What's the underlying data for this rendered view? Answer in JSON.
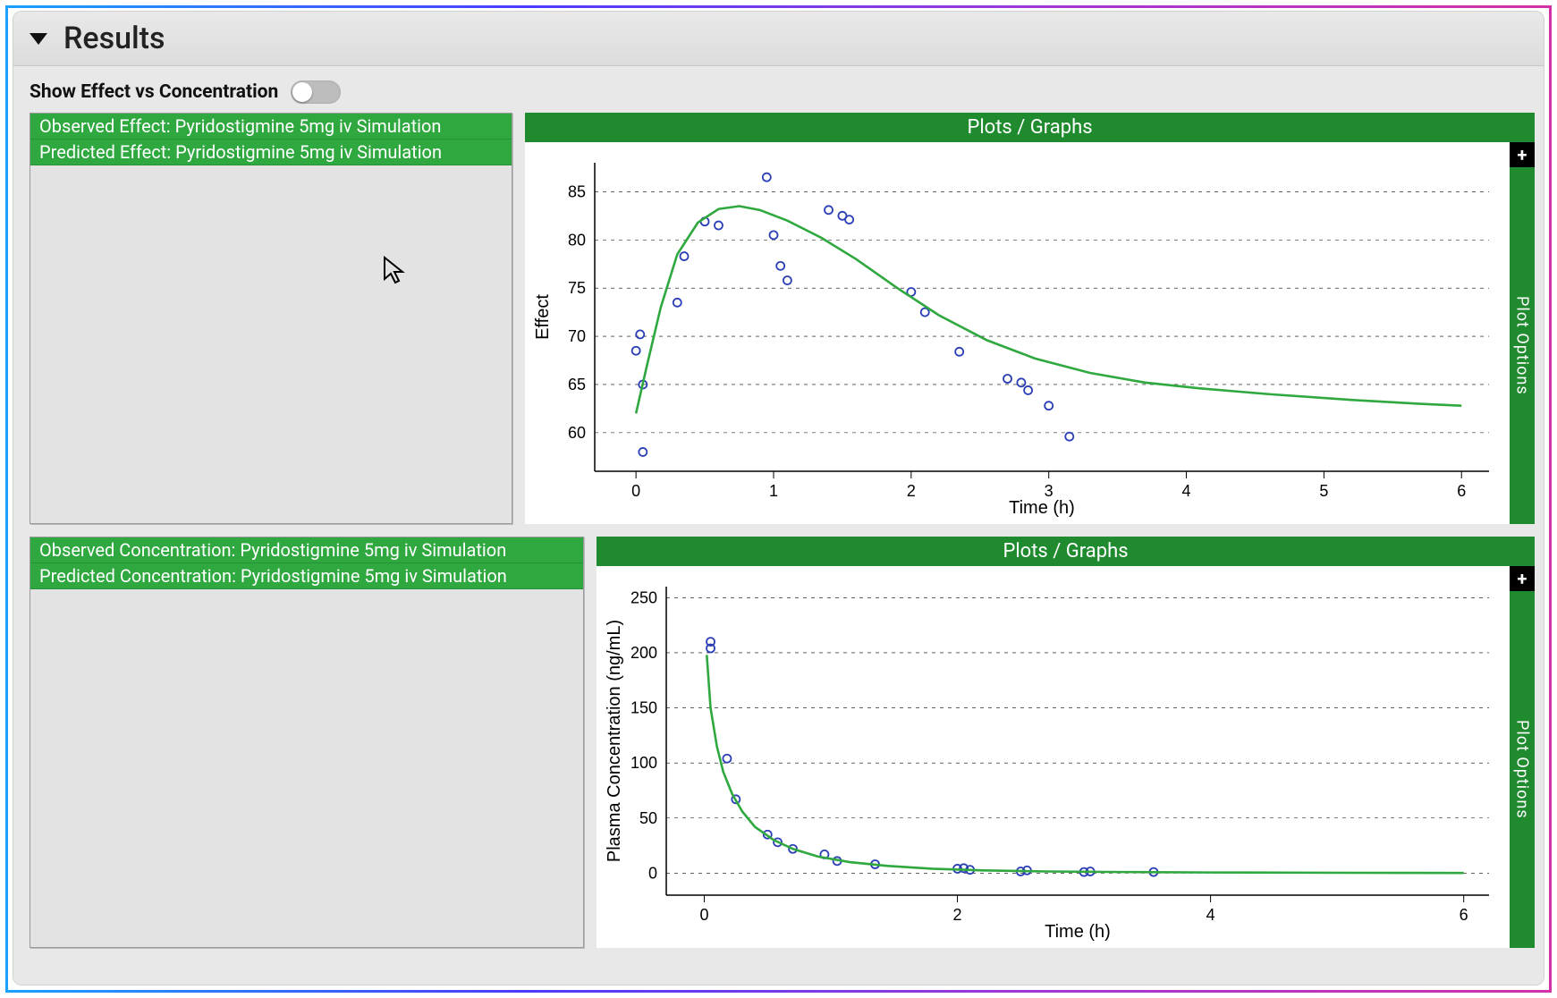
{
  "header": {
    "title": "Results"
  },
  "toggle": {
    "label": "Show Effect vs Concentration",
    "on": false
  },
  "row1": {
    "list_width": 540,
    "list": {
      "items": [
        "Observed Effect: Pyridostigmine 5mg iv Simulation",
        "Predicted Effect: Pyridostigmine 5mg iv Simulation"
      ]
    },
    "chart_title": "Plots / Graphs",
    "plot_options": "Plot Options",
    "plus": "+"
  },
  "row2": {
    "list_width": 620,
    "list": {
      "items": [
        "Observed Concentration: Pyridostigmine 5mg iv Simulation",
        "Predicted Concentration: Pyridostigmine 5mg iv Simulation"
      ]
    },
    "chart_title": "Plots / Graphs",
    "plot_options": "Plot Options",
    "plus": "+"
  },
  "chart_data": [
    {
      "id": "effect-vs-time",
      "type": "scatter+line",
      "title": "",
      "xlabel": "Time (h)",
      "ylabel": "Effect",
      "xlim": [
        -0.3,
        6.2
      ],
      "ylim": [
        56,
        88
      ],
      "xticks": [
        0,
        1,
        2,
        3,
        4,
        5,
        6
      ],
      "yticks": [
        60,
        65,
        70,
        75,
        80,
        85
      ],
      "series": [
        {
          "name": "Observed Effect",
          "type": "scatter",
          "color": "#2a3fb5",
          "points": [
            [
              0.0,
              68.5
            ],
            [
              0.03,
              70.2
            ],
            [
              0.05,
              65.0
            ],
            [
              0.05,
              58.0
            ],
            [
              0.3,
              73.5
            ],
            [
              0.35,
              78.3
            ],
            [
              0.5,
              81.9
            ],
            [
              0.6,
              81.5
            ],
            [
              0.95,
              86.5
            ],
            [
              1.0,
              80.5
            ],
            [
              1.05,
              77.3
            ],
            [
              1.1,
              75.8
            ],
            [
              1.4,
              83.1
            ],
            [
              1.5,
              82.5
            ],
            [
              1.55,
              82.1
            ],
            [
              2.0,
              74.6
            ],
            [
              2.1,
              72.5
            ],
            [
              2.35,
              68.4
            ],
            [
              2.7,
              65.6
            ],
            [
              2.8,
              65.2
            ],
            [
              2.85,
              64.4
            ],
            [
              3.0,
              62.8
            ],
            [
              3.15,
              59.6
            ]
          ]
        },
        {
          "name": "Predicted Effect",
          "type": "line",
          "color": "#2fa83f",
          "points": [
            [
              0.0,
              62.0
            ],
            [
              0.08,
              67.0
            ],
            [
              0.18,
              73.0
            ],
            [
              0.3,
              78.5
            ],
            [
              0.45,
              81.8
            ],
            [
              0.6,
              83.2
            ],
            [
              0.75,
              83.5
            ],
            [
              0.9,
              83.1
            ],
            [
              1.1,
              82.0
            ],
            [
              1.35,
              80.2
            ],
            [
              1.6,
              78.0
            ],
            [
              1.9,
              75.0
            ],
            [
              2.2,
              72.2
            ],
            [
              2.55,
              69.6
            ],
            [
              2.9,
              67.7
            ],
            [
              3.3,
              66.2
            ],
            [
              3.7,
              65.2
            ],
            [
              4.1,
              64.6
            ],
            [
              4.6,
              64.0
            ],
            [
              5.2,
              63.4
            ],
            [
              5.7,
              63.0
            ],
            [
              6.0,
              62.8
            ]
          ]
        }
      ]
    },
    {
      "id": "concentration-vs-time",
      "type": "scatter+line",
      "title": "",
      "xlabel": "Time (h)",
      "ylabel": "Plasma Concentration (ng/mL)",
      "xlim": [
        -0.3,
        6.2
      ],
      "ylim": [
        -20,
        260
      ],
      "xticks": [
        0,
        2,
        4,
        6
      ],
      "yticks": [
        0,
        50,
        100,
        150,
        200,
        250
      ],
      "series": [
        {
          "name": "Observed Concentration",
          "type": "scatter",
          "color": "#2a3fb5",
          "points": [
            [
              0.05,
              204
            ],
            [
              0.05,
              210
            ],
            [
              0.18,
              104
            ],
            [
              0.25,
              67
            ],
            [
              0.5,
              35
            ],
            [
              0.58,
              28
            ],
            [
              0.7,
              22
            ],
            [
              0.95,
              17
            ],
            [
              1.05,
              11
            ],
            [
              1.35,
              8
            ],
            [
              2.0,
              4
            ],
            [
              2.05,
              4.5
            ],
            [
              2.1,
              3
            ],
            [
              2.5,
              1.5
            ],
            [
              2.55,
              2.5
            ],
            [
              3.0,
              1
            ],
            [
              3.05,
              1.5
            ],
            [
              3.55,
              1
            ]
          ]
        },
        {
          "name": "Predicted Concentration",
          "type": "line",
          "color": "#2fa83f",
          "points": [
            [
              0.02,
              198
            ],
            [
              0.05,
              150
            ],
            [
              0.1,
              115
            ],
            [
              0.15,
              92
            ],
            [
              0.22,
              72
            ],
            [
              0.3,
              56
            ],
            [
              0.4,
              42
            ],
            [
              0.55,
              30
            ],
            [
              0.7,
              22
            ],
            [
              0.9,
              15
            ],
            [
              1.15,
              10
            ],
            [
              1.45,
              6.5
            ],
            [
              1.8,
              4
            ],
            [
              2.2,
              2.5
            ],
            [
              2.7,
              1.5
            ],
            [
              3.3,
              1
            ],
            [
              4.0,
              0.6
            ],
            [
              4.8,
              0.4
            ],
            [
              5.5,
              0.2
            ],
            [
              6.0,
              0.15
            ]
          ]
        }
      ]
    }
  ]
}
